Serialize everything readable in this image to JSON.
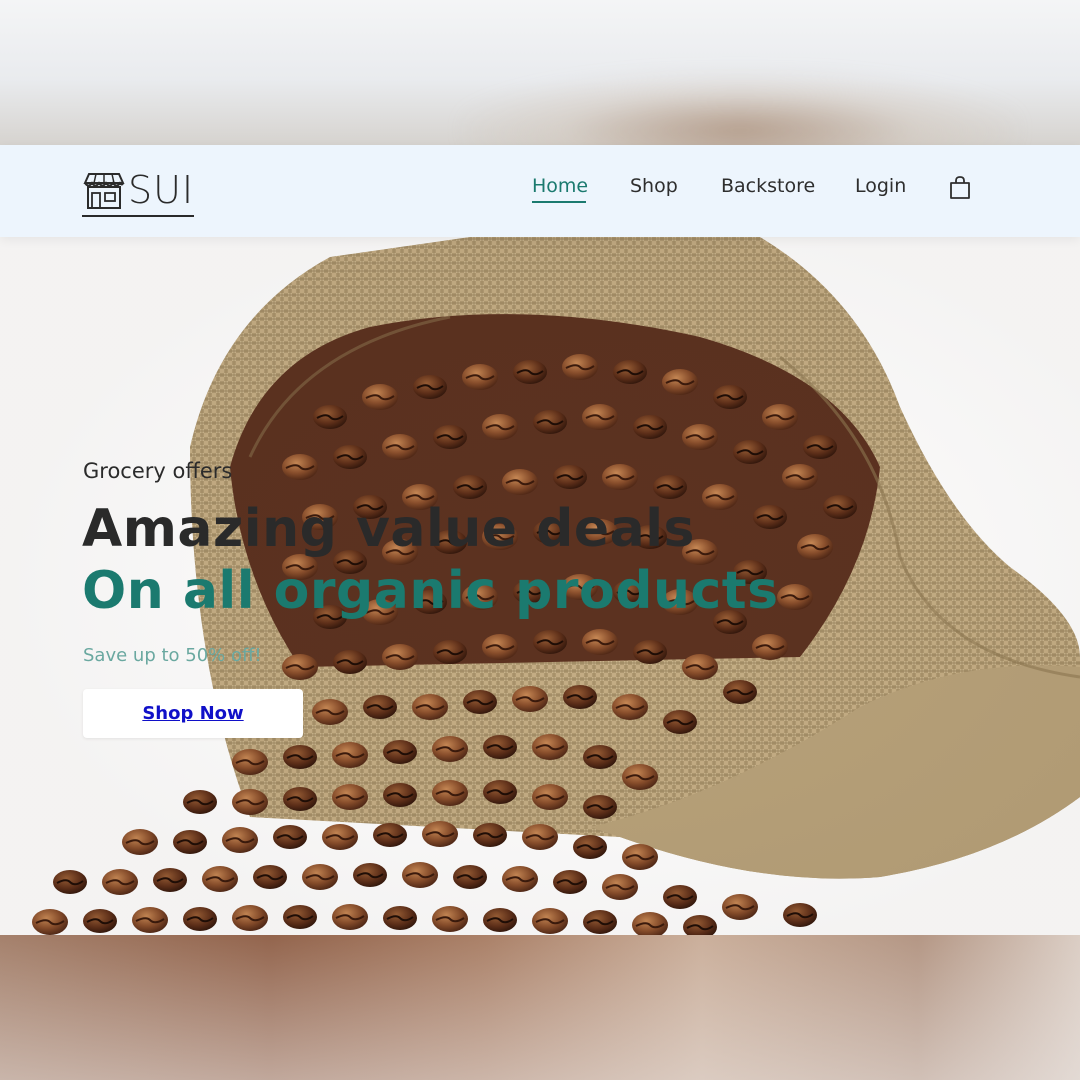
{
  "brand": {
    "logo_text": "SUI",
    "logo_icon": "storefront-icon"
  },
  "nav": {
    "items": [
      {
        "label": "Home",
        "active": true
      },
      {
        "label": "Shop",
        "active": false
      },
      {
        "label": "Backstore",
        "active": false
      },
      {
        "label": "Login",
        "active": false
      }
    ],
    "cart_icon": "shopping-bag-icon"
  },
  "hero": {
    "eyebrow": "Grocery offers",
    "headline_line1": "Amazing value deals",
    "headline_line2": "On all organic products",
    "subtext": "Save up to 50% off!",
    "cta_label": "Shop Now",
    "image": "burlap-sack-of-coffee-beans"
  },
  "colors": {
    "accent": "#1b7a6f",
    "nav_background": "#edf5fd",
    "heading": "#2a2a2a",
    "subtext": "#6aa8a0",
    "cta_link": "#1010c8"
  }
}
